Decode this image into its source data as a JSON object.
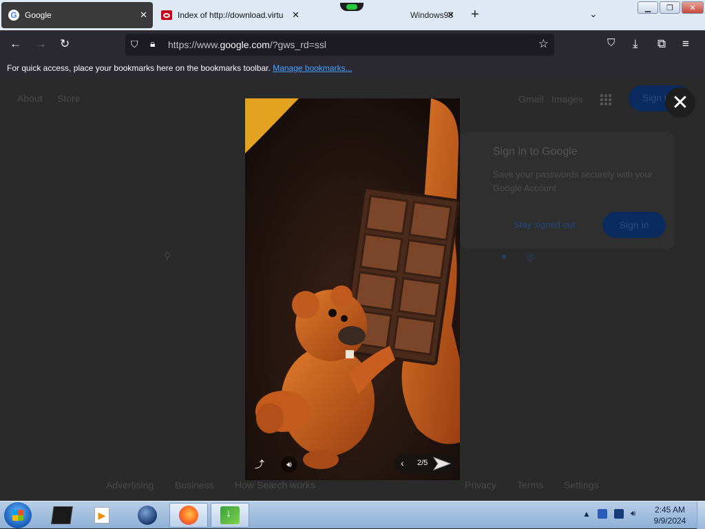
{
  "browser": {
    "tabs": [
      {
        "title": "Google",
        "active": true
      },
      {
        "title": "Index of http://download.virtu",
        "active": false
      },
      {
        "title": "Windows98",
        "active": false
      }
    ],
    "url_prefix": "https://www.",
    "url_domain": "google.com",
    "url_suffix": "/?gws_rd=ssl",
    "bookmarks_text": "For quick access, place your bookmarks here on the bookmarks toolbar.",
    "bookmarks_link": "Manage bookmarks..."
  },
  "google": {
    "top_left": [
      "About",
      "Store"
    ],
    "top_right": [
      "Gmail",
      "Images"
    ],
    "sign_in_button": "Sign in",
    "footer_left": [
      "Advertising",
      "Business",
      "How Search works"
    ],
    "footer_right": [
      "Privacy",
      "Terms",
      "Settings"
    ]
  },
  "signin_popup": {
    "title": "Sign in to Google",
    "body": "Save your passwords securely with your Google Account",
    "stay_signed_out": "Stay signed out",
    "sign_in": "Sign in"
  },
  "viewer": {
    "counter": "2/5"
  },
  "taskbar": {
    "time": "2:45 AM",
    "date": "9/9/2024"
  },
  "colors": {
    "accent_blue": "#0b57d0",
    "link": "#45a1ff",
    "firefox_toolbar": "#2b2a33"
  }
}
